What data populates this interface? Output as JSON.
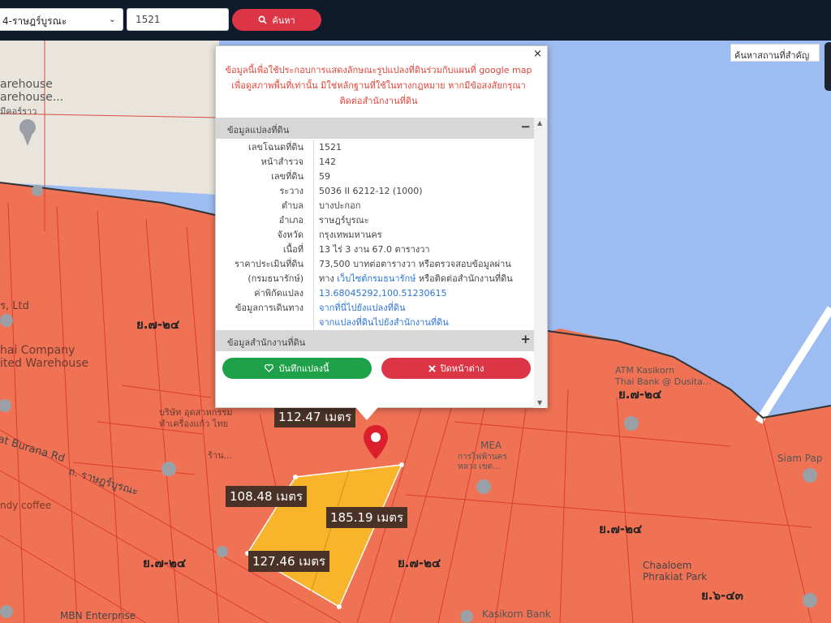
{
  "toolbar": {
    "district_select": "4-ราษฎร์บูรณะ",
    "parcel_input": "1521",
    "search_label": "ค้นหา"
  },
  "map": {
    "place_search_placeholder": "ค้นหาสถานที่สำคัญ",
    "places": {
      "warehouse1": "arehouse",
      "warehouse2": "arehouse...",
      "warehouse3": "มีคอร์ราว",
      "ltd": "ร, Ltd",
      "company": "hai Company",
      "united_warehouse": "ited Warehouse",
      "burana_rd": "at Burana Rd",
      "bk_road": "ถ. ราษฎร์บูรณะ",
      "company_th": "บริษัท อุดสาหกรรม\nทำเครื่องแก้ว ไทย",
      "ndy_coffee": "ndy coffee",
      "mbn": "MBN Enterprise",
      "mea": "MEA",
      "electric": "การไฟฟ้านคร\nหลวง เขต...",
      "atm": "ATM Kasikorn\nThai Bank @ Dusita...",
      "chaloem": "Chaaloem\nPhrakiat Park",
      "kasikorn": "Kasikorn Bank",
      "siam_pap": "Siam Pap",
      "house_top": "ร้าน..."
    },
    "zones": [
      "ย.๗-๒๔",
      "ย.๗-๒๔",
      "ย.๗-๒๔",
      "ย.๗-๒๔",
      "ย.๗-๒๔",
      "ย.๖-๔๓"
    ],
    "measurements": {
      "top": "112.47 เมตร",
      "left": "108.48 เมตร",
      "right": "185.19 เมตร",
      "bottom": "127.46 เมตร"
    }
  },
  "popup": {
    "notice": "ข้อมูลนี้เพื่อใช้ประกอบการแสดงลักษณะรูปแปลงที่ดินร่วมกับแผนที่ google map เพื่อดูสภาพพื้นที่เท่านั้น มิใช่หลักฐานที่ใช้ในทางกฎหมาย หากมีข้อสงสัยกรุณาติดต่อสำนักงานที่ดิน",
    "section_land": "ข้อมูลแปลงที่ดิน",
    "section_office": "ข้อมูลสำนักงานที่ดิน",
    "rows": [
      {
        "label": "เลขโฉนดที่ดิน",
        "value": "1521"
      },
      {
        "label": "หน้าสำรวจ",
        "value": "142"
      },
      {
        "label": "เลขที่ดิน",
        "value": "59"
      },
      {
        "label": "ระวาง",
        "value": "5036 II 6212-12 (1000)"
      },
      {
        "label": "ตำบล",
        "value": "บางปะกอก"
      },
      {
        "label": "อำเภอ",
        "value": "ราษฎร์บูรณะ"
      },
      {
        "label": "จังหวัด",
        "value": "กรุงเทพมหานคร"
      },
      {
        "label": "เนื้อที่",
        "value": "13 ไร่ 3 งาน 67.0 ตารางวา"
      },
      {
        "label": "ราคาประเมินที่ดิน",
        "value": "73,500 บาทต่อตารางวา หรือตรวจสอบข้อมูลผ่าน"
      },
      {
        "label": "(กรมธนารักษ์)",
        "value_prefix": "ทาง ",
        "value_link": "เว็บไซต์กรมธนารักษ์",
        "value_suffix": " หรือติดต่อสำนักงานที่ดิน"
      },
      {
        "label": "ค่าพิกัดแปลง",
        "value_link": "13.68045292,100.51230615"
      },
      {
        "label": "ข้อมูลการเดินทาง",
        "value_link": "จากที่นี่ไปยังแปลงที่ดิน"
      },
      {
        "label": "",
        "value_link": "จากแปลงที่ดินไปยังสำนักงานที่ดิน"
      }
    ],
    "save_label": "บันทึกแปลงนี้",
    "close_label": "ปิดหน้าต่าง",
    "close_x": "×",
    "toggle_minus": "−",
    "toggle_plus": "+"
  },
  "colors": {
    "topbar": "#0f1a2b",
    "water": "#9dbdf2",
    "zone_orange": "#f07255",
    "parcel_yellow": "#f8b52c",
    "accent_red": "#dc3545",
    "accent_green": "#1fa14a"
  }
}
